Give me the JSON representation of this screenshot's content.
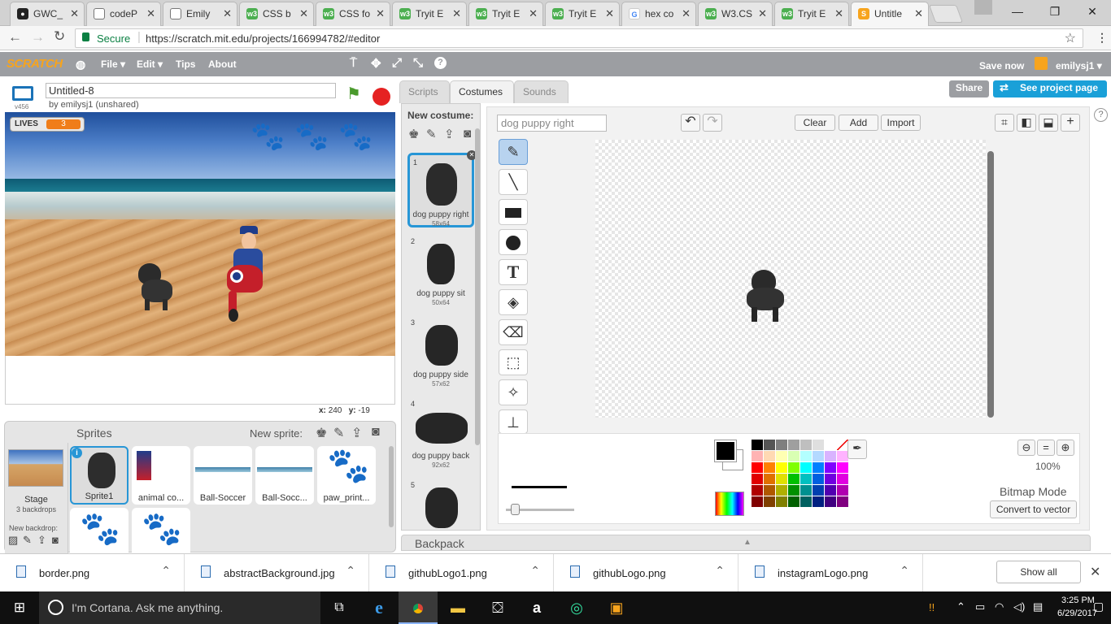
{
  "browser": {
    "tabs": [
      {
        "label": "GWC_",
        "icon": "github-icon",
        "color": "#222222"
      },
      {
        "label": "codeP",
        "icon": "document-icon",
        "color": "#666666"
      },
      {
        "label": "Emily",
        "icon": "document-icon",
        "color": "#666666"
      },
      {
        "label": "CSS b",
        "icon": "w3schools-icon",
        "color": "#4caf50"
      },
      {
        "label": "CSS fo",
        "icon": "w3schools-icon",
        "color": "#4caf50"
      },
      {
        "label": "Tryit E",
        "icon": "w3schools-icon",
        "color": "#4caf50"
      },
      {
        "label": "Tryit E",
        "icon": "w3schools-icon",
        "color": "#4caf50"
      },
      {
        "label": "Tryit E",
        "icon": "w3schools-icon",
        "color": "#4caf50"
      },
      {
        "label": "hex co",
        "icon": "google-icon",
        "color": "#4285f4"
      },
      {
        "label": "W3.CS",
        "icon": "w3schools-icon",
        "color": "#4caf50"
      },
      {
        "label": "Tryit E",
        "icon": "w3schools-icon",
        "color": "#4caf50"
      },
      {
        "label": "Untitle",
        "icon": "scratch-icon",
        "color": "#f7a41d"
      }
    ],
    "secure_label": "Secure",
    "url": "https://scratch.mit.edu/projects/166994782/#editor"
  },
  "scratch_menu": {
    "logo": "SCRATCH",
    "file": "File ▾",
    "edit": "Edit ▾",
    "tips": "Tips",
    "about": "About",
    "save_now": "Save now",
    "user": "emilysj1 ▾"
  },
  "stage": {
    "version": "v456",
    "title": "Untitled-8",
    "byline": "by emilysj1 (unshared)",
    "lives_label": "LIVES",
    "lives_value": "3",
    "coord_x_label": "x:",
    "coord_x": "240",
    "coord_y_label": "y:",
    "coord_y": "-19"
  },
  "sprites_panel": {
    "title": "Sprites",
    "new_sprite_label": "New sprite:",
    "stage_label": "Stage",
    "stage_backdrops": "3 backdrops",
    "new_backdrop_label": "New backdrop:",
    "sprites": [
      {
        "name": "Sprite1",
        "selected": true
      },
      {
        "name": "animal co..."
      },
      {
        "name": "Ball-Soccer"
      },
      {
        "name": "Ball-Socc..."
      },
      {
        "name": "paw_print..."
      }
    ]
  },
  "editor": {
    "tabs": [
      "Scripts",
      "Costumes",
      "Sounds"
    ],
    "active_tab": "Costumes",
    "share": "Share",
    "see_project": "See project page",
    "new_costume_label": "New costume:",
    "costumes": [
      {
        "num": "1",
        "name": "dog puppy right",
        "size": "58x64"
      },
      {
        "num": "2",
        "name": "dog puppy sit",
        "size": "50x64"
      },
      {
        "num": "3",
        "name": "dog puppy side",
        "size": "57x62"
      },
      {
        "num": "4",
        "name": "dog puppy back",
        "size": "92x62"
      },
      {
        "num": "5",
        "name": "",
        "size": ""
      }
    ],
    "costume_name": "dog puppy right",
    "clear": "Clear",
    "add": "Add",
    "import": "Import",
    "zoom": "100%",
    "mode": "Bitmap Mode",
    "convert": "Convert to vector",
    "backpack": "Backpack",
    "palette": [
      "#000000",
      "#555555",
      "#7f7f7f",
      "#9f9f9f",
      "#bfbfbf",
      "#dfdfdf",
      "#ffffff",
      "#ffffff",
      "#ffb3b3",
      "#ffd9b3",
      "#ffffb3",
      "#d9ffb3",
      "#b3ffff",
      "#b3d9ff",
      "#d9b3ff",
      "#ffb3ff",
      "#ff0000",
      "#ff8000",
      "#ffff00",
      "#80ff00",
      "#00ffff",
      "#0080ff",
      "#8000ff",
      "#ff00ff",
      "#e00000",
      "#e07000",
      "#e0e000",
      "#00c000",
      "#00c0c0",
      "#0060e0",
      "#7000e0",
      "#e000e0",
      "#b00000",
      "#b05800",
      "#b0b000",
      "#009000",
      "#009090",
      "#0040b0",
      "#5000b0",
      "#b000b0",
      "#800000",
      "#804000",
      "#808000",
      "#006000",
      "#006060",
      "#002080",
      "#400080",
      "#800080"
    ]
  },
  "downloads": {
    "files": [
      "border.png",
      "abstractBackground.jpg",
      "githubLogo1.png",
      "githubLogo.png",
      "instagramLogo.png"
    ],
    "show_all": "Show all"
  },
  "taskbar": {
    "cortana": "I'm Cortana. Ask me anything.",
    "time": "3:25 PM",
    "date": "6/29/2017"
  }
}
